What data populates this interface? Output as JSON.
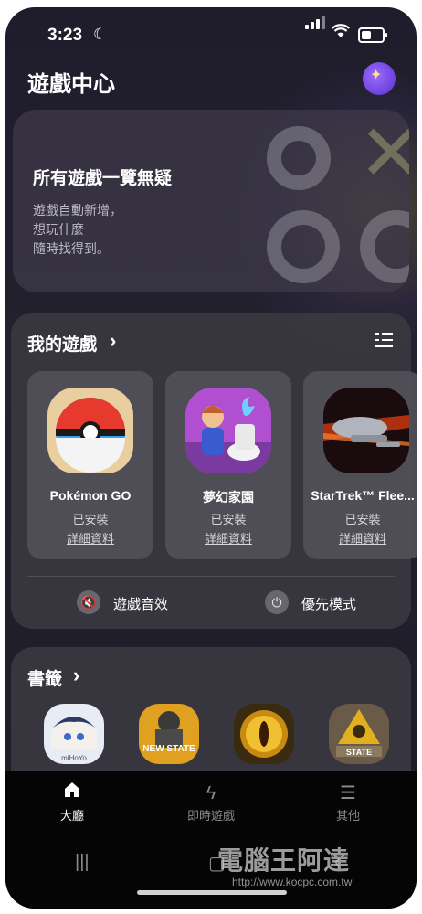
{
  "status_bar": {
    "time": "3:23"
  },
  "header": {
    "title": "遊戲中心"
  },
  "hero": {
    "title": "所有遊戲一覽無疑",
    "desc_lines": [
      "遊戲自動新增，",
      "想玩什麼",
      "隨時找得到。"
    ]
  },
  "my_games": {
    "title": "我的遊戲",
    "games": [
      {
        "name": "Pokémon GO",
        "status": "已安裝",
        "details": "詳細資料"
      },
      {
        "name": "夢幻家園",
        "status": "已安裝",
        "details": "詳細資料"
      },
      {
        "name": "StarTrek™ Flee...",
        "status": "已安裝",
        "details": "詳細資料"
      }
    ],
    "toggles": [
      {
        "label": "遊戲音效",
        "icon": "mute-icon"
      },
      {
        "label": "優先模式",
        "icon": "power-icon"
      }
    ]
  },
  "bookmarks": {
    "title": "書籤",
    "items": [
      {
        "icon": "genshin-app-icon",
        "caption": "miHoYo"
      },
      {
        "icon": "pubg-new-state-app-icon",
        "caption": "NEW STATE"
      },
      {
        "icon": "eye-ring-app-icon",
        "caption": ""
      },
      {
        "icon": "state-of-survival-app-icon",
        "caption": "STATE"
      }
    ]
  },
  "bottom_nav": {
    "items": [
      {
        "label": "大廳",
        "icon": "home-icon",
        "active": true
      },
      {
        "label": "即時遊戲",
        "icon": "lightning-icon",
        "active": false
      },
      {
        "label": "其他",
        "icon": "menu-icon",
        "active": false
      }
    ]
  },
  "watermark": {
    "text": "電腦王阿達",
    "url": "http://www.kocpc.com.tw"
  },
  "colors": {
    "background": "#221f2c",
    "card": "#3a3840",
    "nav": "#050505"
  }
}
